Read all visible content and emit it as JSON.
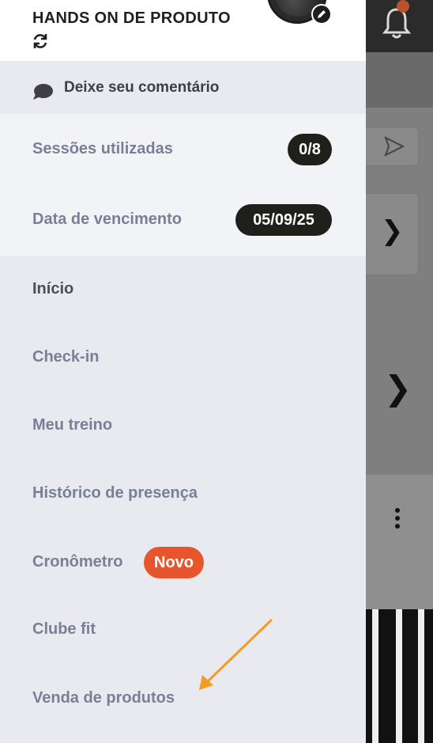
{
  "header": {
    "title": "HANDS ON DE PRODUTO"
  },
  "comment": {
    "label": "Deixe seu comentário"
  },
  "info": {
    "sessions_label": "Sessões utilizadas",
    "sessions_value": "0/8",
    "due_label": "Data de vencimento",
    "due_value": "05/09/25"
  },
  "menu": {
    "items": [
      {
        "label": "Início"
      },
      {
        "label": "Check-in"
      },
      {
        "label": "Meu treino"
      },
      {
        "label": "Histórico de presença"
      },
      {
        "label": "Cronômetro",
        "badge": "Novo"
      },
      {
        "label": "Clube fit"
      },
      {
        "label": "Venda de produtos"
      }
    ]
  },
  "colors": {
    "accent_badge": "#e8542c",
    "annotation_arrow": "#f59a23",
    "pill_bg": "#1f201c"
  },
  "icons": {
    "refresh": "refresh-icon",
    "edit": "pencil-icon",
    "comment": "chat-bubble-icon",
    "bell": "bell-icon",
    "send": "send-icon",
    "chevron": "chevron-right-icon",
    "more": "more-vertical-icon"
  }
}
